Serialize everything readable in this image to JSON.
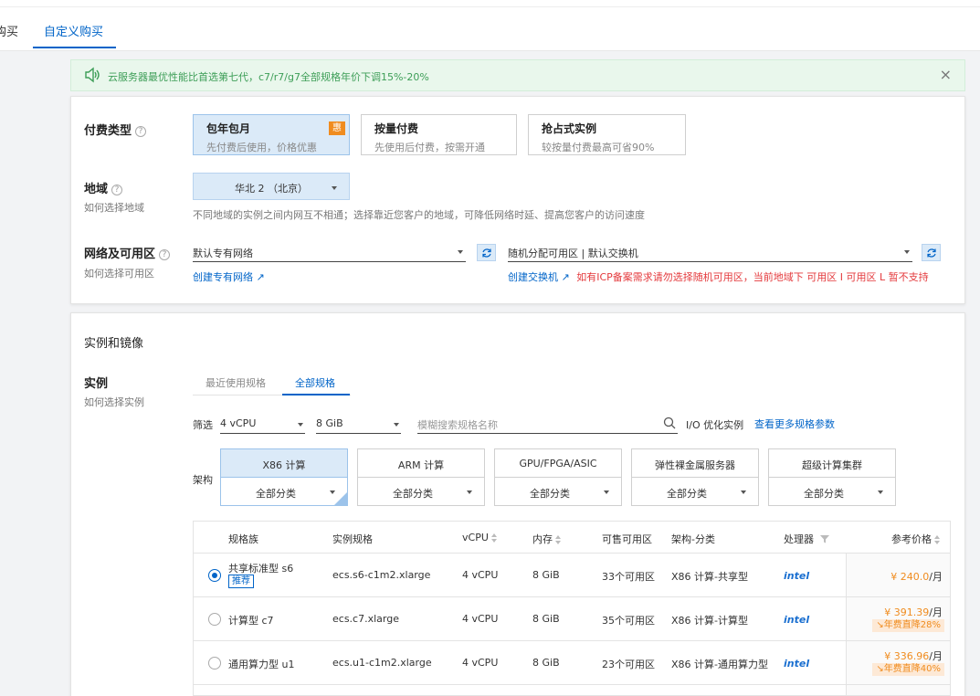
{
  "tabs": [
    "购买",
    "自定义购买"
  ],
  "banner": {
    "text": "云服务器最优性能比首选第七代，c7/r7/g7全部规格年价下调15%-20%",
    "close": "×"
  },
  "payment": {
    "label": "付费类型",
    "options": [
      {
        "title": "包年包月",
        "desc": "先付费后使用，价格优惠",
        "badge": "惠"
      },
      {
        "title": "按量付费",
        "desc": "先使用后付费，按需开通"
      },
      {
        "title": "抢占式实例",
        "desc": "较按量付费最高可省90%"
      }
    ]
  },
  "region": {
    "label": "地域",
    "sub": "如何选择地域",
    "value": "华北 2 （北京）",
    "hint": "不同地域的实例之间内网互不相通；选择靠近您客户的地域，可降低网络时延、提高您客户的访问速度"
  },
  "network": {
    "label": "网络及可用区",
    "sub": "如何选择可用区",
    "vpc_value": "默认专有网络",
    "vpc_link": "创建专有网络",
    "zone_value": "随机分配可用区 | 默认交换机",
    "switch_link": "创建交换机",
    "warning": "如有ICP备案需求请勿选择随机可用区，当前地域下 可用区 I 可用区 L 暂不支持"
  },
  "instance_section": {
    "title": "实例和镜像",
    "label": "实例",
    "sub": "如何选择实例",
    "subtabs": [
      "最近使用规格",
      "全部规格"
    ],
    "filter_label": "筛选",
    "cpu": "4 vCPU",
    "mem": "8 GiB",
    "search_placeholder": "模糊搜索规格名称",
    "io_opt": "I/O 优化实例",
    "more_params": "查看更多规格参数",
    "arch_label": "架构",
    "arch": [
      {
        "name": "X86 计算",
        "sub": "全部分类"
      },
      {
        "name": "ARM 计算",
        "sub": "全部分类"
      },
      {
        "name": "GPU/FPGA/ASIC",
        "sub": "全部分类"
      },
      {
        "name": "弹性裸金属服务器",
        "sub": "全部分类"
      },
      {
        "name": "超级计算集群",
        "sub": "全部分类"
      }
    ]
  },
  "table": {
    "headers": [
      "规格族",
      "实例规格",
      "vCPU",
      "内存",
      "可售可用区",
      "架构-分类",
      "处理器",
      "参考价格"
    ],
    "rows": [
      {
        "family": "共享标准型 s6",
        "badge": "推荐",
        "spec": "ecs.s6-c1m2.xlarge",
        "vcpu": "4 vCPU",
        "mem": "8 GiB",
        "zones": "33个可用区",
        "arch": "X86 计算-共享型",
        "cpu": "intel",
        "price": "¥ 240.0",
        "unit": "/月",
        "discount": ""
      },
      {
        "family": "计算型 c7",
        "badge": "",
        "spec": "ecs.c7.xlarge",
        "vcpu": "4 vCPU",
        "mem": "8 GiB",
        "zones": "35个可用区",
        "arch": "X86 计算-计算型",
        "cpu": "intel",
        "price": "¥ 391.39",
        "unit": "/月",
        "discount": "年费直降28%"
      },
      {
        "family": "通用算力型 u1",
        "badge": "",
        "spec": "ecs.u1-c1m2.xlarge",
        "vcpu": "4 vCPU",
        "mem": "8 GiB",
        "zones": "23个可用区",
        "arch": "X86 计算-通用算力型",
        "cpu": "intel",
        "price": "¥ 336.96",
        "unit": "/月",
        "discount": "年费直降40%"
      }
    ]
  },
  "colors": {
    "accent": "#0064c8",
    "orange": "#f08c1f",
    "green": "#3d9e57",
    "red": "#e4393c"
  }
}
